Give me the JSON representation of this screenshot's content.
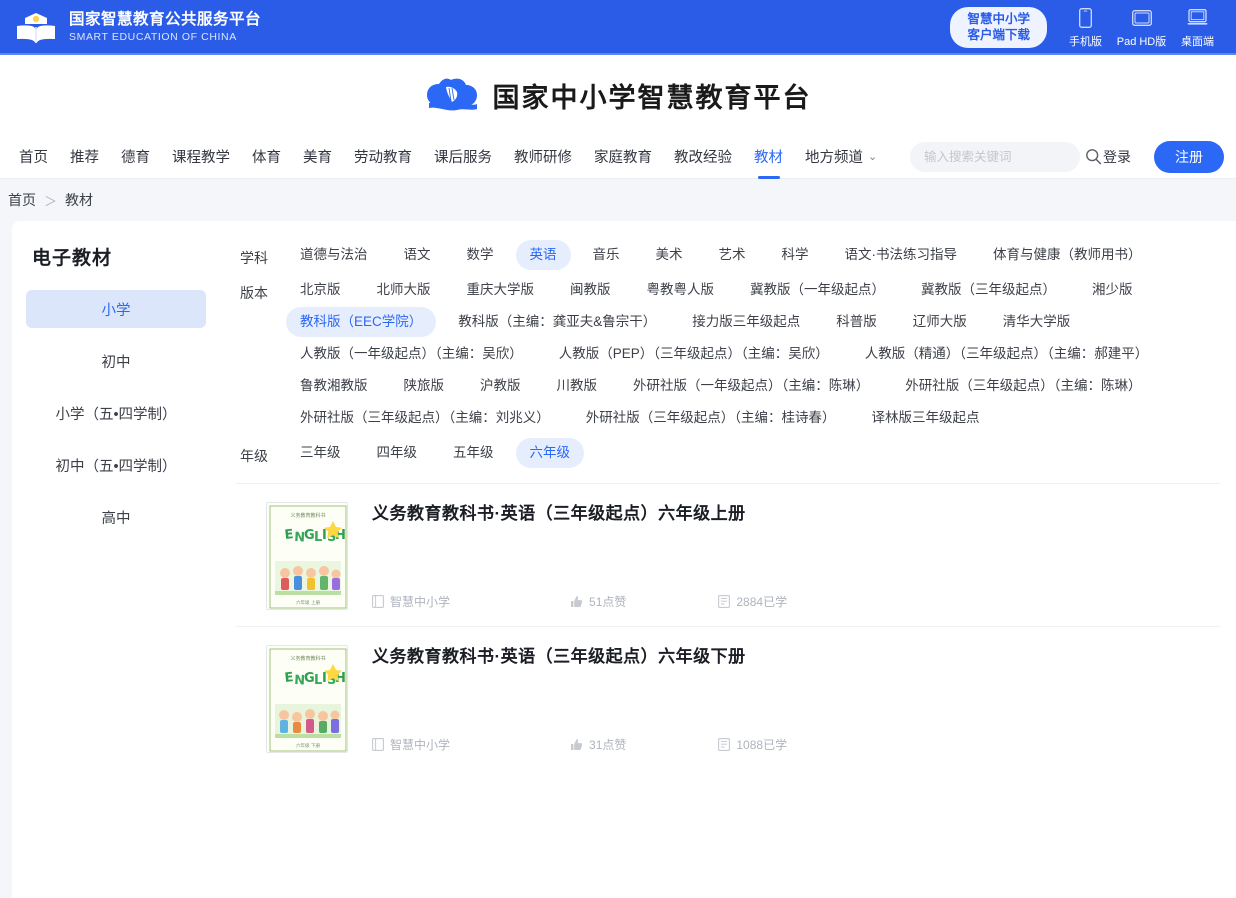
{
  "topbar": {
    "gov_title_cn": "国家智慧教育公共服务平台",
    "gov_title_en": "SMART EDUCATION OF CHINA",
    "download_line1": "智慧中小学",
    "download_line2": "客户端下载",
    "platforms": [
      {
        "icon": "phone-icon",
        "label": "手机版"
      },
      {
        "icon": "tablet-icon",
        "label": "Pad HD版"
      },
      {
        "icon": "desktop-icon",
        "label": "桌面端"
      }
    ],
    "accent": "#2a5ce8"
  },
  "brand": {
    "name": "国家中小学智慧教育平台",
    "logo_icon": "cloud-book-icon"
  },
  "nav": {
    "items": [
      {
        "label": "首页",
        "active": false
      },
      {
        "label": "推荐",
        "active": false
      },
      {
        "label": "德育",
        "active": false
      },
      {
        "label": "课程教学",
        "active": false
      },
      {
        "label": "体育",
        "active": false
      },
      {
        "label": "美育",
        "active": false
      },
      {
        "label": "劳动教育",
        "active": false
      },
      {
        "label": "课后服务",
        "active": false
      },
      {
        "label": "教师研修",
        "active": false
      },
      {
        "label": "家庭教育",
        "active": false
      },
      {
        "label": "教改经验",
        "active": false
      },
      {
        "label": "教材",
        "active": true
      },
      {
        "label": "地方频道",
        "active": false,
        "has_caret": true
      }
    ],
    "search": {
      "placeholder": "输入搜索关键词",
      "value": "",
      "icon": "search-icon"
    },
    "login_label": "登录",
    "register_label": "注册",
    "active_color": "#2a68f5"
  },
  "breadcrumb": {
    "home": "首页",
    "separator": "＞",
    "current": "教材"
  },
  "sidebar": {
    "title": "电子教材",
    "items": [
      {
        "label": "小学",
        "active": true
      },
      {
        "label": "初中",
        "active": false
      },
      {
        "label": "小学（五•四学制）",
        "active": false
      },
      {
        "label": "初中（五•四学制）",
        "active": false
      },
      {
        "label": "高中",
        "active": false
      }
    ]
  },
  "filters": [
    {
      "label": "学科",
      "rows": [
        [
          {
            "label": "道德与法治",
            "active": false
          },
          {
            "label": "语文",
            "active": false
          },
          {
            "label": "数学",
            "active": false
          },
          {
            "label": "英语",
            "active": true
          },
          {
            "label": "音乐",
            "active": false
          },
          {
            "label": "美术",
            "active": false
          },
          {
            "label": "艺术",
            "active": false
          },
          {
            "label": "科学",
            "active": false
          },
          {
            "label": "语文·书法练习指导",
            "active": false
          },
          {
            "label": "体育与健康（教师用书）",
            "active": false
          }
        ]
      ]
    },
    {
      "label": "版本",
      "rows": [
        [
          {
            "label": "北京版",
            "active": false
          },
          {
            "label": "北师大版",
            "active": false
          },
          {
            "label": "重庆大学版",
            "active": false
          },
          {
            "label": "闽教版",
            "active": false
          },
          {
            "label": "粤教粤人版",
            "active": false
          },
          {
            "label": "冀教版（一年级起点）",
            "active": false
          },
          {
            "label": "冀教版（三年级起点）",
            "active": false
          },
          {
            "label": "湘少版",
            "active": false
          }
        ],
        [
          {
            "label": "教科版（EEC学院）",
            "active": true
          },
          {
            "label": "教科版（主编：龚亚夫&鲁宗干）",
            "active": false
          },
          {
            "label": "接力版三年级起点",
            "active": false
          },
          {
            "label": "科普版",
            "active": false
          },
          {
            "label": "辽师大版",
            "active": false
          },
          {
            "label": "清华大学版",
            "active": false
          }
        ],
        [
          {
            "label": "人教版（一年级起点）（主编：吴欣）",
            "active": false
          },
          {
            "label": "人教版（PEP）（三年级起点）（主编：吴欣）",
            "active": false
          },
          {
            "label": "人教版（精通）（三年级起点）（主编：郝建平）",
            "active": false
          }
        ],
        [
          {
            "label": "鲁教湘教版",
            "active": false
          },
          {
            "label": "陕旅版",
            "active": false
          },
          {
            "label": "沪教版",
            "active": false
          },
          {
            "label": "川教版",
            "active": false
          },
          {
            "label": "外研社版（一年级起点）（主编：陈琳）",
            "active": false
          },
          {
            "label": "外研社版（三年级起点）（主编：陈琳）",
            "active": false
          }
        ],
        [
          {
            "label": "外研社版（三年级起点）（主编：刘兆义）",
            "active": false
          },
          {
            "label": "外研社版（三年级起点）（主编：桂诗春）",
            "active": false
          },
          {
            "label": "译林版三年级起点",
            "active": false
          }
        ]
      ]
    },
    {
      "label": "年级",
      "rows": [
        [
          {
            "label": "三年级",
            "active": false
          },
          {
            "label": "四年级",
            "active": false
          },
          {
            "label": "五年级",
            "active": false
          },
          {
            "label": "六年级",
            "active": true
          }
        ]
      ]
    }
  ],
  "books": [
    {
      "title": "义务教育教科书·英语（三年级起点）六年级上册",
      "cover_label": "ENGLISH",
      "cover_sub": "义务教育教科书",
      "source": "智慧中小学",
      "likes": "51点赞",
      "studied": "2884已学",
      "icons": {
        "source": "book-icon",
        "likes": "thumbs-up-icon",
        "studied": "study-icon"
      }
    },
    {
      "title": "义务教育教科书·英语（三年级起点）六年级下册",
      "cover_label": "ENGLISH",
      "cover_sub": "义务教育教科书",
      "source": "智慧中小学",
      "likes": "31点赞",
      "studied": "1088已学",
      "icons": {
        "source": "book-icon",
        "likes": "thumbs-up-icon",
        "studied": "study-icon"
      }
    }
  ]
}
